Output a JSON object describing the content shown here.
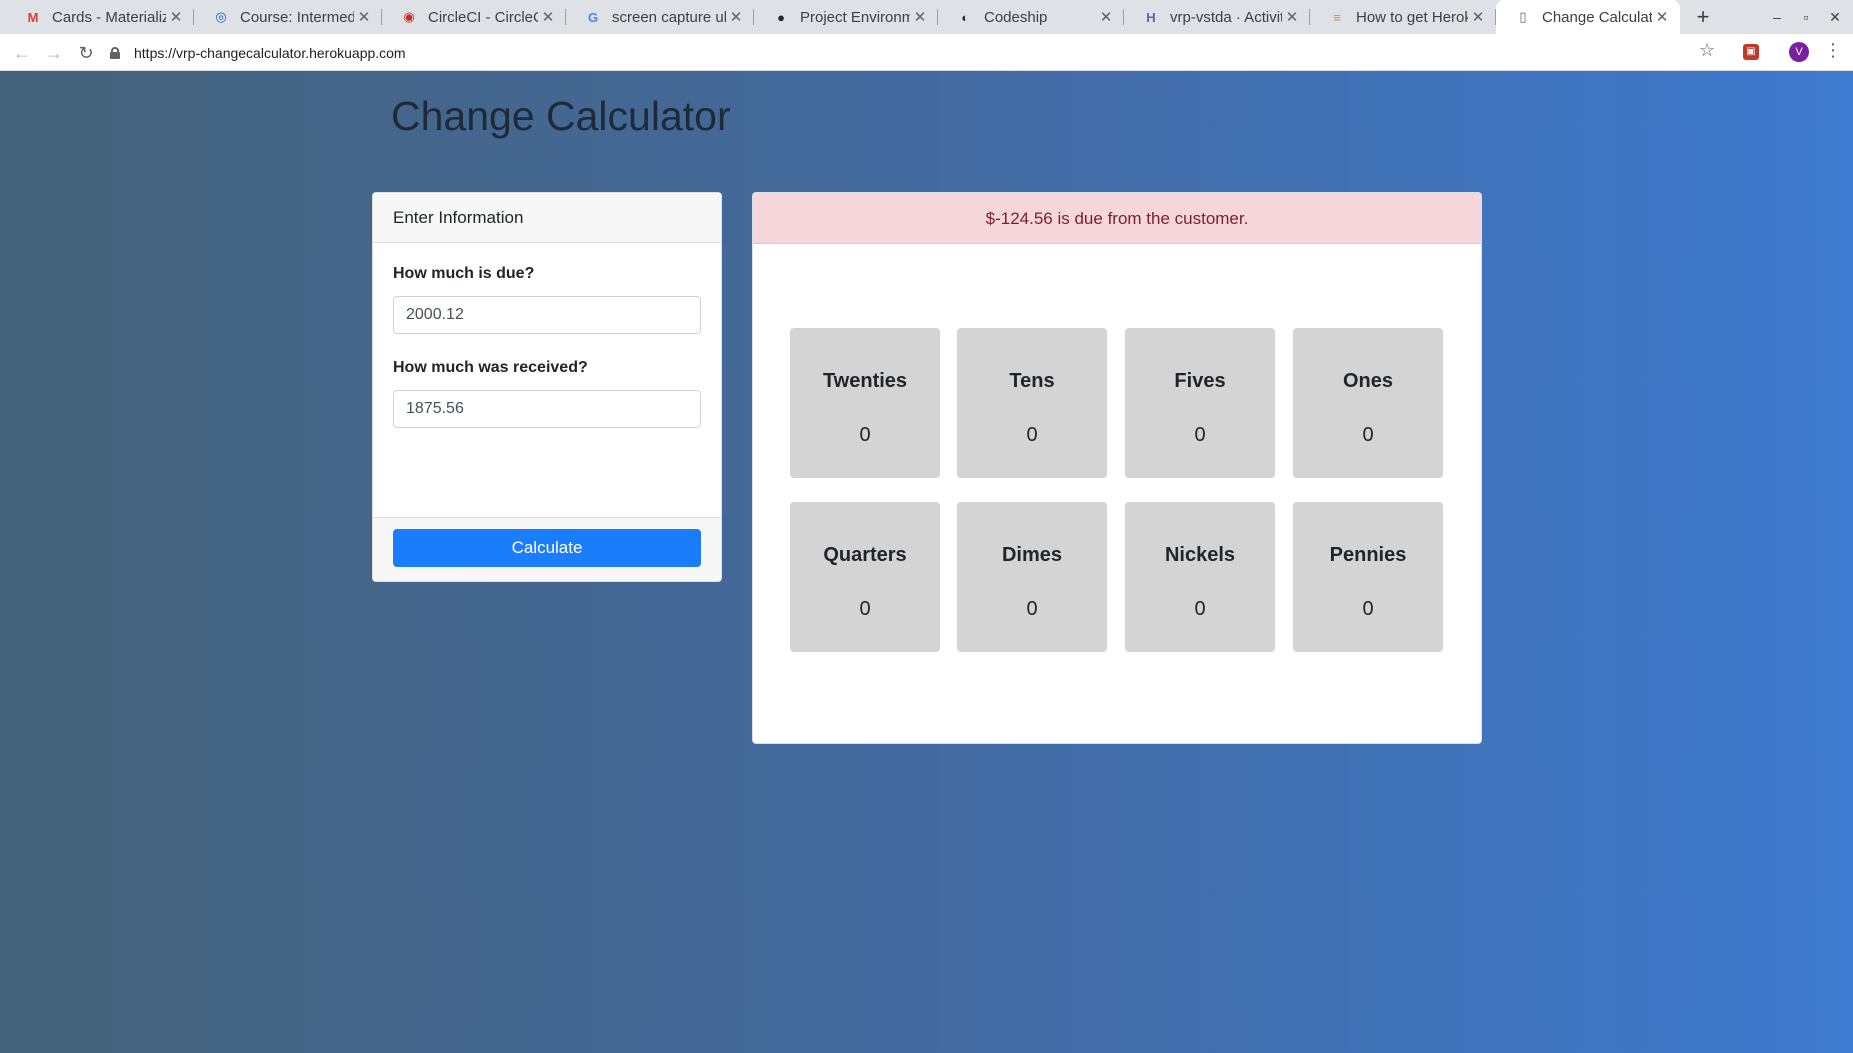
{
  "browser": {
    "tabs": [
      {
        "title": "Cards - Materialize",
        "icon": "materialize-icon",
        "glyph": "M",
        "color": "#e53935"
      },
      {
        "title": "Course: Intermediate",
        "icon": "course-icon",
        "glyph": "◎",
        "color": "#1565c0"
      },
      {
        "title": "CircleCI - CircleCI",
        "icon": "circleci-icon",
        "glyph": "◉",
        "color": "#c62828"
      },
      {
        "title": "screen capture ubuntu",
        "icon": "google-icon",
        "glyph": "G",
        "color": "#4285f4"
      },
      {
        "title": "Project Environment",
        "icon": "github-icon",
        "glyph": "●",
        "color": "#24292e"
      },
      {
        "title": "Codeship",
        "icon": "codeship-icon",
        "glyph": "◐",
        "color": "#333333"
      },
      {
        "title": "vrp-vstda · Activity",
        "icon": "heroku-icon",
        "glyph": "H",
        "color": "#6762a6"
      },
      {
        "title": "How to get Heroku",
        "icon": "stackoverflow-icon",
        "glyph": "≡",
        "color": "#f48024"
      },
      {
        "title": "Change Calculator",
        "icon": "document-icon",
        "glyph": "▯",
        "color": "#5f6368"
      }
    ],
    "url": "https://vrp-changecalculator.herokuapp.com",
    "avatar_letter": "V"
  },
  "page": {
    "title": "Change Calculator"
  },
  "form": {
    "header": "Enter Information",
    "due_label": "How much is due?",
    "due_value": "2000.12",
    "received_label": "How much was received?",
    "received_value": "1875.56",
    "button_label": "Calculate"
  },
  "result": {
    "message": "$-124.56 is due from the customer.",
    "denominations": [
      {
        "name": "Twenties",
        "count": "0"
      },
      {
        "name": "Tens",
        "count": "0"
      },
      {
        "name": "Fives",
        "count": "0"
      },
      {
        "name": "Ones",
        "count": "0"
      },
      {
        "name": "Quarters",
        "count": "0"
      },
      {
        "name": "Dimes",
        "count": "0"
      },
      {
        "name": "Nickels",
        "count": "0"
      },
      {
        "name": "Pennies",
        "count": "0"
      }
    ]
  },
  "colors": {
    "accent": "#1a7dfb",
    "alert_bg": "#f5d6da",
    "alert_text": "#7c1f2a",
    "tile_bg": "#d4d4d4"
  }
}
